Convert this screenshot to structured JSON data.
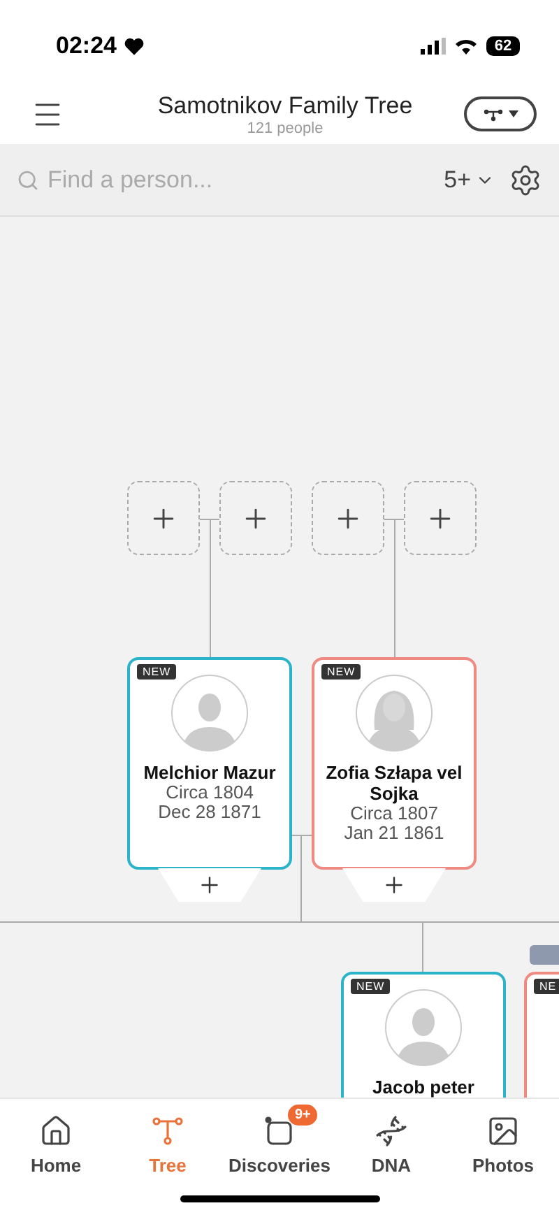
{
  "status_bar": {
    "time": "02:24",
    "battery": "62"
  },
  "header": {
    "title": "Samotnikov Family Tree",
    "subtitle": "121 people"
  },
  "search": {
    "placeholder": "Find a person...",
    "generations": "5+"
  },
  "empty_slots": [
    {
      "kind": "add"
    },
    {
      "kind": "add"
    },
    {
      "kind": "add"
    },
    {
      "kind": "add"
    }
  ],
  "people": [
    {
      "kind": "male",
      "badge": "NEW",
      "name": "Melchior Mazur",
      "birth": "Circa 1804",
      "death": "Dec 28 1871",
      "add_child": true
    },
    {
      "kind": "female",
      "badge": "NEW",
      "name": "Zofia Szłapa vel Sojka",
      "birth": "Circa 1807",
      "death": "Jan 21 1861",
      "add_child": true
    },
    {
      "kind": "male",
      "badge": "NEW",
      "name": "Jacob peter"
    },
    {
      "kind": "female",
      "badge": "NE"
    }
  ],
  "tabs": [
    {
      "kind": "home",
      "label": "Home",
      "selected": false
    },
    {
      "kind": "tree",
      "label": "Tree",
      "selected": true
    },
    {
      "kind": "discoveries",
      "label": "Discoveries",
      "selected": false,
      "badge": "9+"
    },
    {
      "kind": "dna",
      "label": "DNA",
      "selected": false
    },
    {
      "kind": "photos",
      "label": "Photos",
      "selected": false
    }
  ]
}
